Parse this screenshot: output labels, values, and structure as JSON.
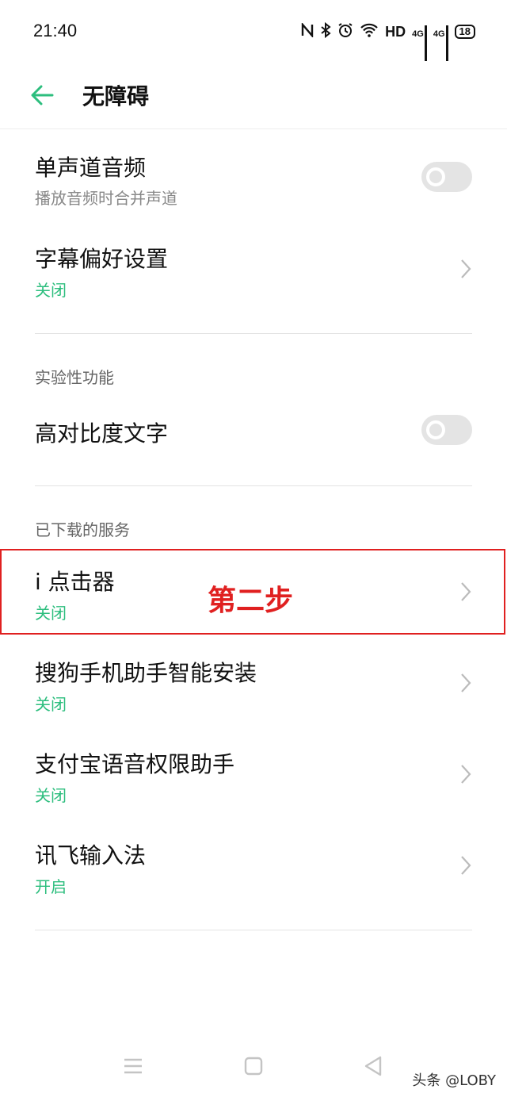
{
  "status_bar": {
    "time": "21:40",
    "hd_label": "HD",
    "net1": "4G",
    "net2": "4G",
    "battery": "18"
  },
  "header": {
    "title": "无障碍"
  },
  "items": {
    "mono_audio": {
      "title": "单声道音频",
      "subtitle": "播放音频时合并声道",
      "toggle_on": false
    },
    "captions": {
      "title": "字幕偏好设置",
      "status": "关闭"
    },
    "high_contrast": {
      "title": "高对比度文字",
      "toggle_on": false
    },
    "iclicker": {
      "title": "i 点击器",
      "status": "关闭"
    },
    "sogou": {
      "title": "搜狗手机助手智能安装",
      "status": "关闭"
    },
    "alipay": {
      "title": "支付宝语音权限助手",
      "status": "关闭"
    },
    "xunfei": {
      "title": "讯飞输入法",
      "status": "开启"
    }
  },
  "sections": {
    "experimental": "实验性功能",
    "downloaded": "已下载的服务"
  },
  "annotation": {
    "text": "第二步"
  },
  "watermark": {
    "text": "头条 @LOBY"
  },
  "colors": {
    "accent": "#2dbe7e",
    "annotation": "#e02020"
  }
}
